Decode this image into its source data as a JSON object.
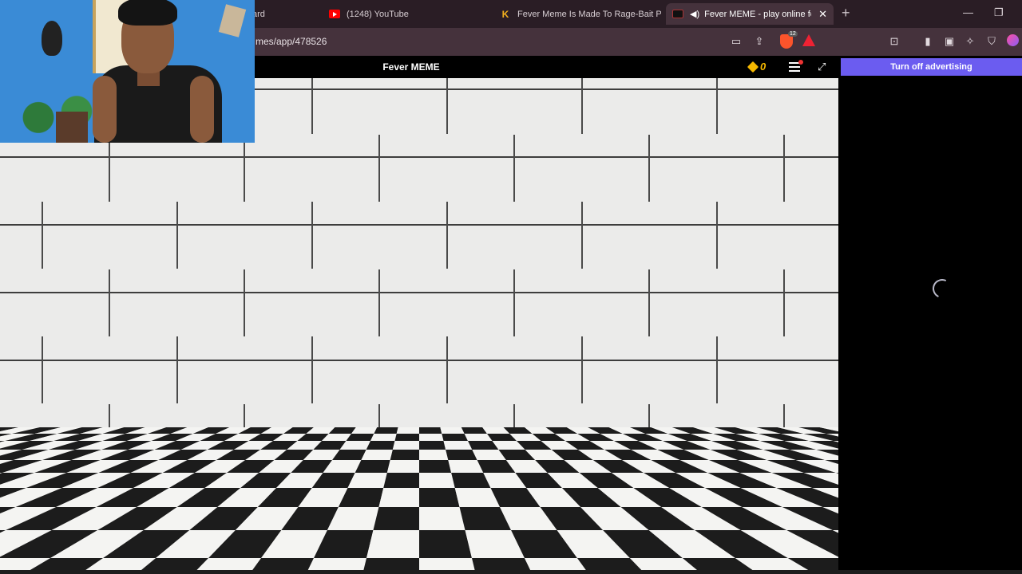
{
  "browser": {
    "tabs": [
      {
        "label": "ard",
        "icon": "none"
      },
      {
        "label": "(1248) YouTube",
        "icon": "youtube-icon"
      },
      {
        "label": "Fever Meme Is Made To Rage-Bait Pe",
        "icon": "tk-icon"
      },
      {
        "label": "Fever MEME - play online for",
        "icon": "game-favicon",
        "active": true
      }
    ],
    "new_tab_symbol": "+",
    "url": "mes/app/478526",
    "brave_badge": "12"
  },
  "game": {
    "title": "Fever MEME",
    "coins": "0"
  },
  "ad": {
    "button_label": "Turn off advertising"
  },
  "colors": {
    "accent_purple": "#6b5cf0",
    "coin_gold": "#f5b800",
    "chrome_bg": "#2a1d25"
  }
}
